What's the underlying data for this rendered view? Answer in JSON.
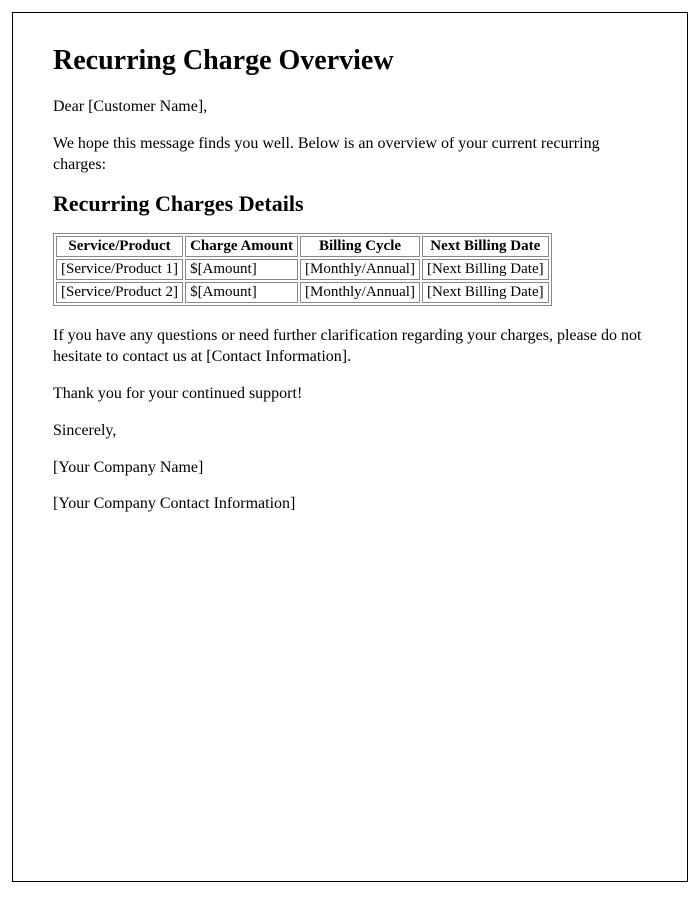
{
  "title": "Recurring Charge Overview",
  "greeting": "Dear [Customer Name],",
  "intro": "We hope this message finds you well. Below is an overview of your current recurring charges:",
  "details_heading": "Recurring Charges Details",
  "table": {
    "headers": {
      "service": "Service/Product",
      "amount": "Charge Amount",
      "cycle": "Billing Cycle",
      "next": "Next Billing Date"
    },
    "rows": [
      {
        "service": "[Service/Product 1]",
        "amount": "$[Amount]",
        "cycle": "[Monthly/Annual]",
        "next": "[Next Billing Date]"
      },
      {
        "service": "[Service/Product 2]",
        "amount": "$[Amount]",
        "cycle": "[Monthly/Annual]",
        "next": "[Next Billing Date]"
      }
    ]
  },
  "contact_note": "If you have any questions or need further clarification regarding your charges, please do not hesitate to contact us at [Contact Information].",
  "thanks": "Thank you for your continued support!",
  "signoff": "Sincerely,",
  "company_name": "[Your Company Name]",
  "company_contact": "[Your Company Contact Information]"
}
